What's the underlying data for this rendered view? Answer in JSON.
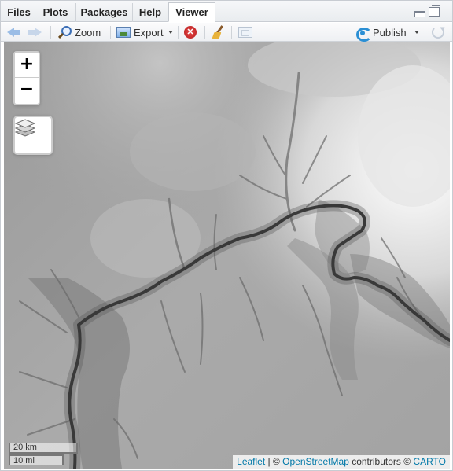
{
  "tabs": [
    {
      "label": "Files"
    },
    {
      "label": "Plots"
    },
    {
      "label": "Packages"
    },
    {
      "label": "Help"
    },
    {
      "label": "Viewer",
      "active": true
    }
  ],
  "toolbar": {
    "zoom_label": "Zoom",
    "export_label": "Export",
    "publish_label": "Publish"
  },
  "map": {
    "zoom_in_label": "+",
    "zoom_out_label": "−",
    "scale_km": "20 km",
    "scale_mi": "10 mi",
    "attribution": {
      "leaflet": "Leaflet",
      "separator": " | © ",
      "osm": "OpenStreetMap",
      "contributors": " contributors © ",
      "carto": "CARTO"
    }
  },
  "colors": {
    "link": "#0078a8",
    "publish_accent": "#2b8fd4",
    "close_red": "#c62828"
  }
}
